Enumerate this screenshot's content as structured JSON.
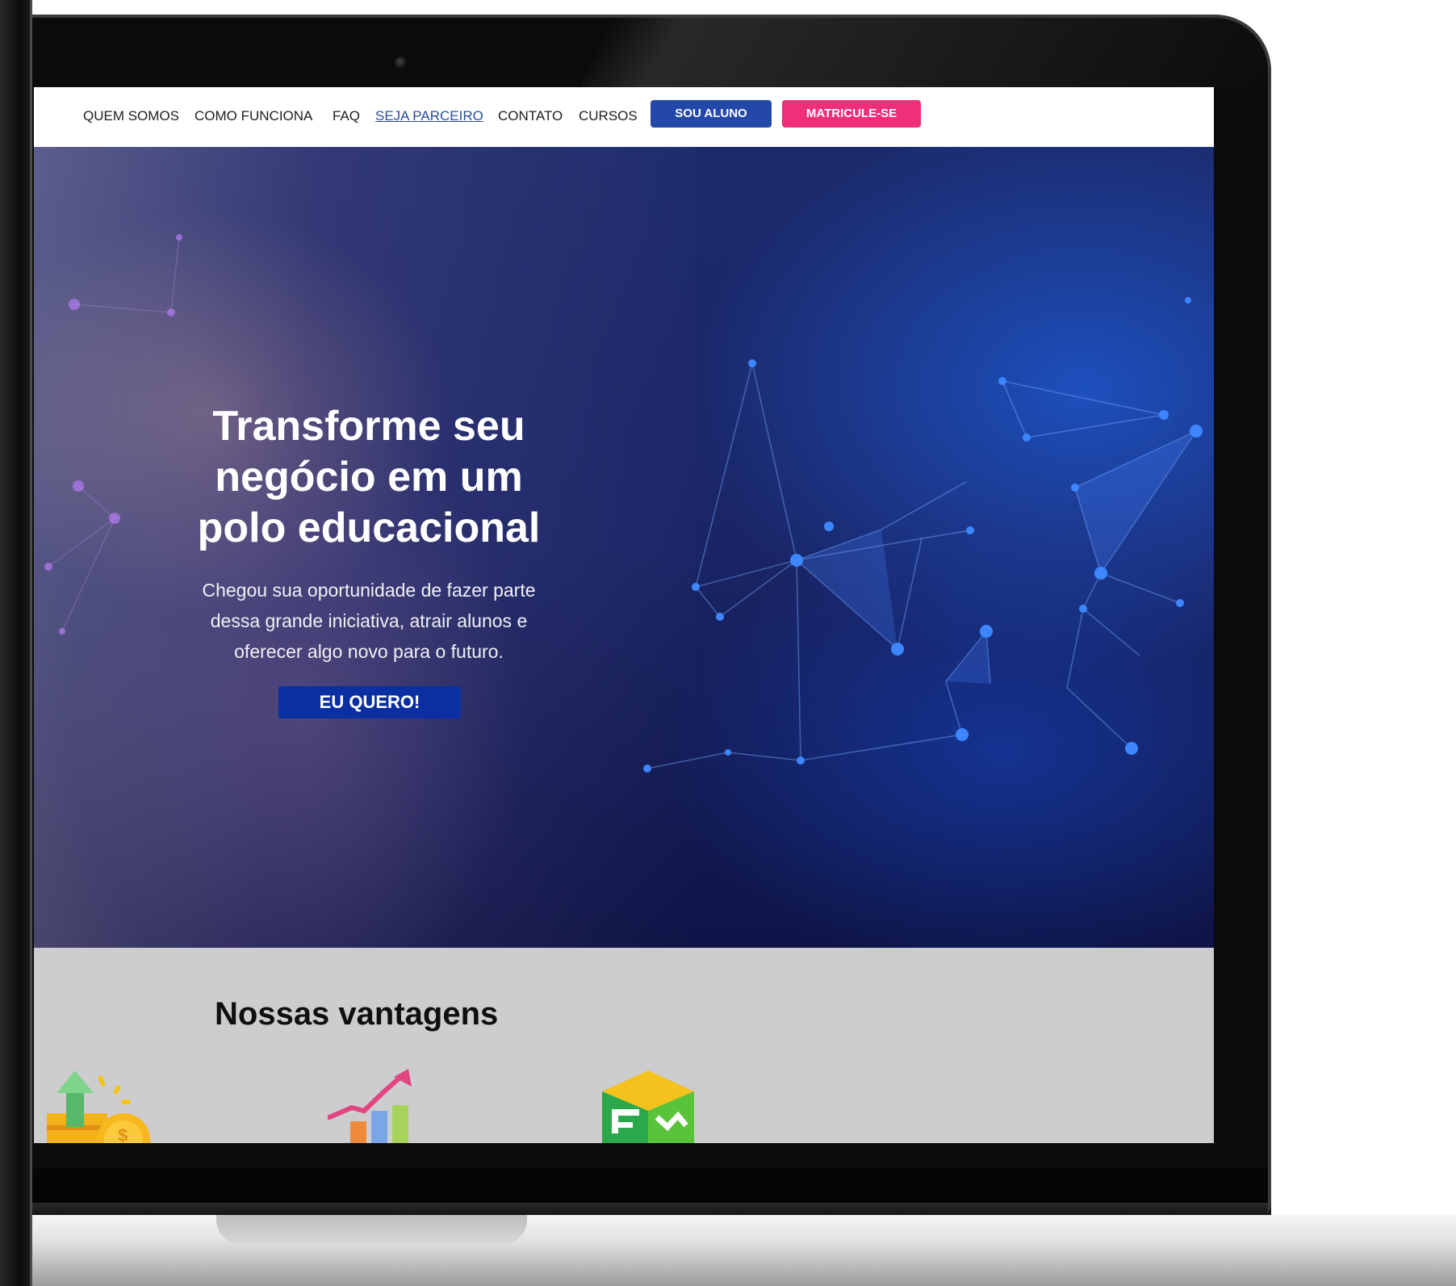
{
  "nav": {
    "links": [
      "QUEM SOMOS",
      "COMO FUNCIONA",
      "FAQ",
      "SEJA PARCEIRO",
      "CONTATO",
      "CURSOS"
    ],
    "aluno_label": "SOU ALUNO",
    "matricule_label": "MATRICULE-SE"
  },
  "hero": {
    "title_lines": [
      "Transforme seu",
      "negócio em um",
      "polo educacional"
    ],
    "subtitle_lines": [
      "Chegou sua oportunidade de fazer parte",
      "dessa grande iniciativa, atrair alunos e",
      "oferecer algo novo para o futuro."
    ],
    "cta_label": "EU QUERO!"
  },
  "advantages": {
    "title": "Nossas vantagens",
    "icons": [
      "money-growth-icon",
      "growth-chart-icon",
      "3d-box-icon"
    ]
  },
  "colors": {
    "primary_blue": "#2448a8",
    "pink": "#ee2f7a",
    "cta_blue": "#0a2fa0",
    "link_active": "#2a4c9e"
  }
}
